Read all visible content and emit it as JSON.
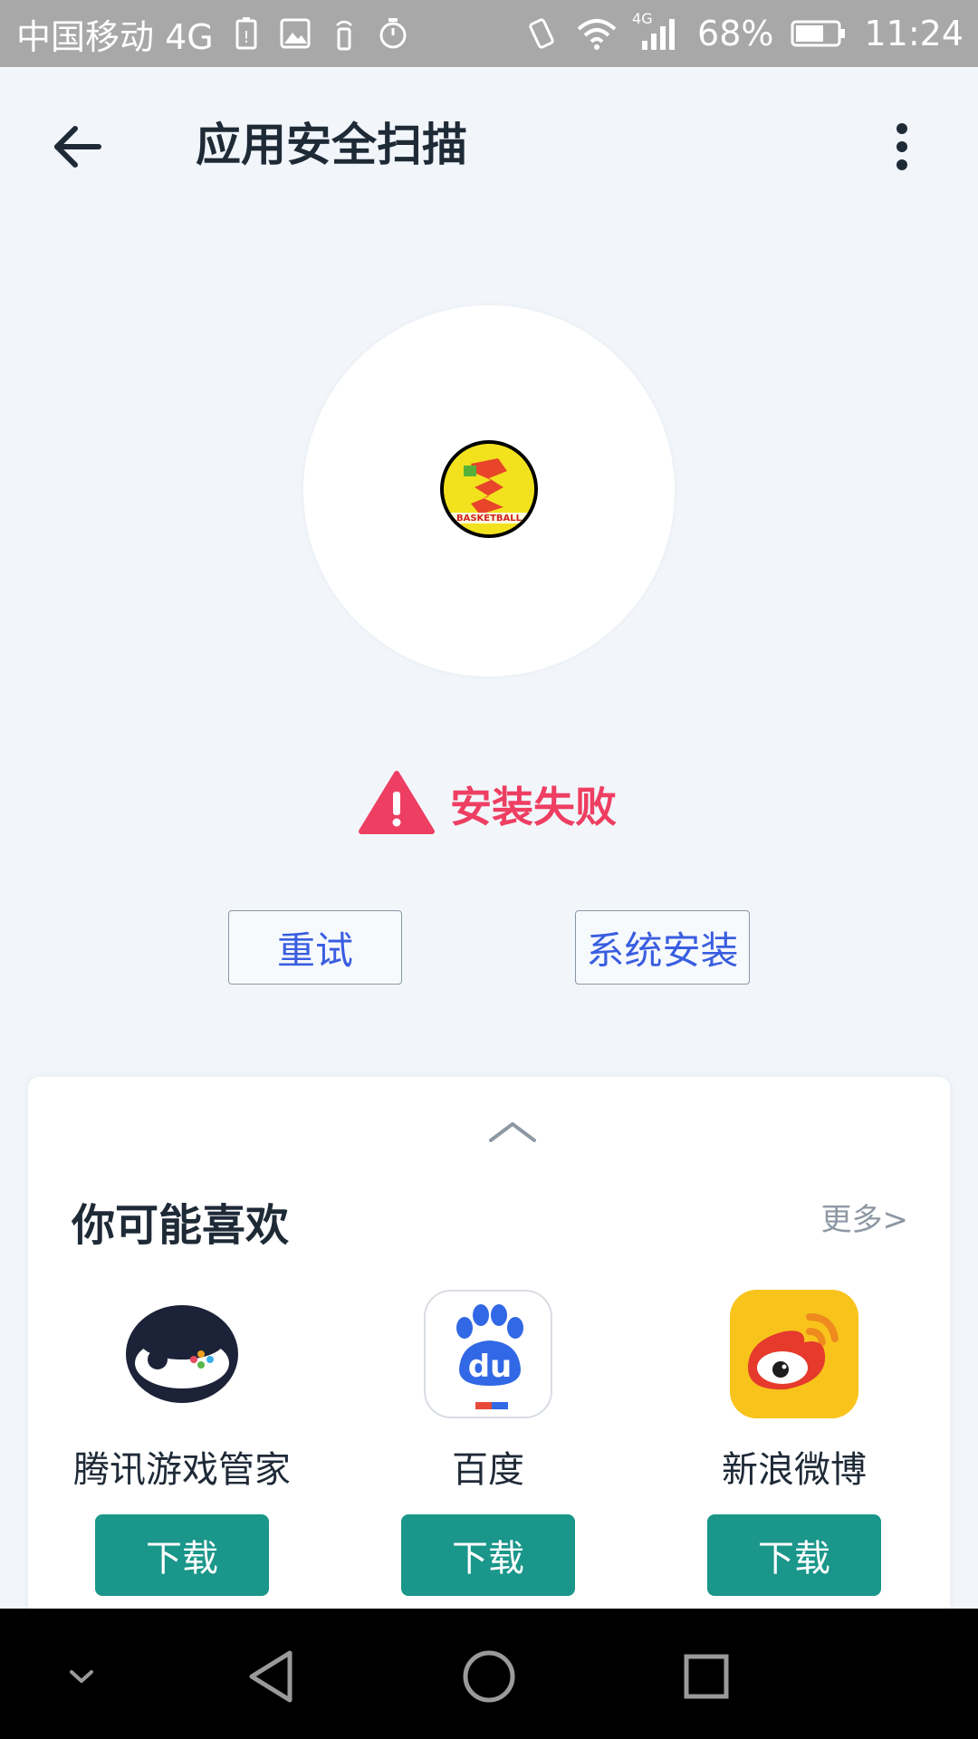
{
  "status_bar": {
    "carrier": "中国移动 4G",
    "network_badge": "4G",
    "battery": "68%",
    "time": "11:24",
    "icons_left": [
      "battery-warning-icon",
      "image-icon",
      "signal-tower-icon",
      "timer-icon"
    ],
    "icons_right": [
      "vibrate-icon",
      "wifi-icon",
      "cell-signal-icon",
      "battery-icon"
    ]
  },
  "header": {
    "title": "应用安全扫描",
    "back_icon": "arrow-left-icon",
    "menu_icon": "more-vertical-icon"
  },
  "scan": {
    "app_logo_text": "BASKETBALL",
    "status_text": "安装失败",
    "status_icon": "warning-triangle-icon",
    "status_color": "#ee3e62"
  },
  "actions": {
    "retry_label": "重试",
    "system_install_label": "系统安装"
  },
  "recommend": {
    "title": "你可能喜欢",
    "more_label": "更多>",
    "apps": [
      {
        "name": "腾讯游戏管家",
        "button": "下载",
        "icon": "tencent-game-icon"
      },
      {
        "name": "百度",
        "button": "下载",
        "icon": "baidu-icon"
      },
      {
        "name": "新浪微博",
        "button": "下载",
        "icon": "weibo-icon"
      }
    ]
  },
  "nav": {
    "icons": [
      "chevron-down-icon",
      "nav-back-icon",
      "nav-home-icon",
      "nav-recents-icon"
    ]
  },
  "colors": {
    "accent_blue": "#3a5ee0",
    "download_green": "#1a968a",
    "background": "#f2f6fb"
  }
}
